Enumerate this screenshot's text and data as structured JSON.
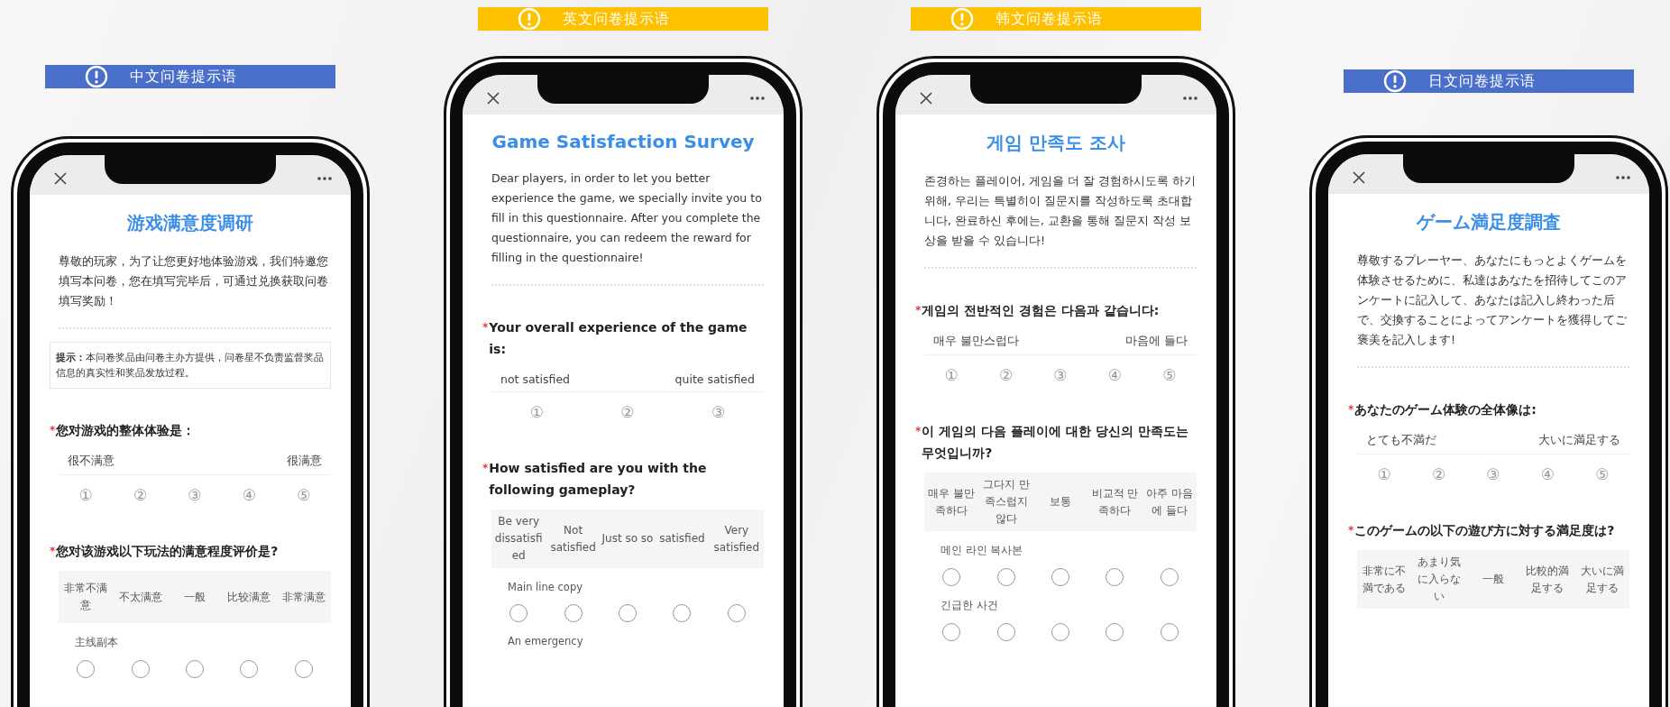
{
  "panels": [
    {
      "banner": {
        "label": "中文问卷提示语",
        "color": "#4a6fcb"
      },
      "screen": {
        "title": "游戏满意度调研",
        "intro": "尊敬的玩家，为了让您更好地体验游戏，我们特邀您填写本问卷，您在填写完毕后，可通过兑换获取问卷填写奖励！",
        "notice": "**提示：**本问卷奖品由问卷主办方提供，问卷星不负责监督奖品信息的真实性和奖品发放过程。",
        "q1": {
          "mark": "*",
          "prompt": "您对游戏的整体体验是：",
          "low": "很不满意",
          "high": "很满意",
          "options": [
            "①",
            "②",
            "③",
            "④",
            "⑤"
          ]
        },
        "q2": {
          "mark": "*",
          "prompt": "您对该游戏以下玩法的满意程度评价是?",
          "columns": [
            "非常不满意",
            "不太满意",
            "一般",
            "比较满意",
            "非常满意"
          ],
          "rows": [
            {
              "label": "主线副本",
              "answers": [
                {
                  "selected": false
                },
                {
                  "selected": false
                },
                {
                  "selected": false
                },
                {
                  "selected": false
                },
                {
                  "selected": false
                }
              ]
            }
          ]
        }
      }
    },
    {
      "banner": {
        "label": "英文问卷提示语",
        "color": "#ffc000"
      },
      "screen": {
        "title": "Game Satisfaction Survey",
        "intro": "Dear players, in order to let you better experience the game, we specially invite you to fill in this questionnaire. After you complete the questionnaire, you can redeem the reward for filling in the questionnaire!",
        "q1": {
          "mark": "*",
          "prompt": "Your overall experience of the game is:",
          "low": "not satisfied",
          "high": "quite satisfied",
          "options": [
            "①",
            "②",
            "③"
          ]
        },
        "q2": {
          "mark": "*",
          "prompt": "How satisfied are you with the following gameplay?",
          "columns": [
            "Be very dissatisfied",
            "Not satisfied",
            "Just so so",
            "satisfied",
            "Very satisfied"
          ],
          "rows": [
            {
              "label": "Main line copy",
              "answers": [
                {
                  "selected": false
                },
                {
                  "selected": false
                },
                {
                  "selected": false
                },
                {
                  "selected": false
                },
                {
                  "selected": false
                }
              ]
            },
            {
              "label": "An emergency"
            }
          ]
        }
      }
    },
    {
      "banner": {
        "label": "韩文问卷提示语",
        "color": "#ffc000"
      },
      "screen": {
        "title": "게임 만족도 조사",
        "intro": "존경하는 플레이어, 게임을 더 잘 경험하시도록 하기 위해, 우리는 특별히이 질문지를 작성하도록 초대합니다, 완료하신 후에는, 교환을 통해 질문지 작성 보상을 받을 수 있습니다!",
        "q1": {
          "mark": "*",
          "prompt": "게임의 전반적인 경험은 다음과 같습니다:",
          "low": "매우 불만스럽다",
          "high": "마음에 들다",
          "options": [
            "①",
            "②",
            "③",
            "④",
            "⑤"
          ]
        },
        "q2": {
          "mark": "*",
          "prompt": "이 게임의 다음 플레이에 대한 당신의 만족도는 무엇입니까?",
          "columns": [
            "매우 불만족하다",
            "그다지 만족스럽지 않다",
            "보통",
            "비교적 만족하다",
            "아주 마음에 들다"
          ],
          "rows": [
            {
              "label": "메인 라인 복사본",
              "answers": [
                {
                  "selected": false
                },
                {
                  "selected": false
                },
                {
                  "selected": false
                },
                {
                  "selected": false
                },
                {
                  "selected": false
                }
              ]
            },
            {
              "label": "긴급한 사건",
              "answers": [
                {
                  "selected": false
                },
                {
                  "selected": false
                },
                {
                  "selected": false
                },
                {
                  "selected": false
                },
                {
                  "selected": false
                }
              ]
            }
          ]
        }
      }
    },
    {
      "banner": {
        "label": "日文问卷提示语",
        "color": "#4a6fcb"
      },
      "screen": {
        "title": "ゲーム満足度調査",
        "intro": "尊敬するプレーヤー、あなたにもっとよくゲームを体験させるために、私達はあなたを招待してこのアンケートに記入して、あなたは記入し終わった后で、交換することによってアンケートを獲得してご褒美を記入します!",
        "q1": {
          "mark": "*",
          "prompt": "あなたのゲーム体験の全体像は:",
          "low": "とても不満だ",
          "high": "大いに満足する",
          "options": [
            "①",
            "②",
            "③",
            "④",
            "⑤"
          ]
        },
        "q2": {
          "mark": "*",
          "prompt": "このゲームの以下の遊び方に対する満足度は?",
          "columns": [
            "非常に不満である",
            "あまり気に入らない",
            "一般",
            "比較的満足する",
            "大いに満足する"
          ]
        }
      }
    }
  ]
}
